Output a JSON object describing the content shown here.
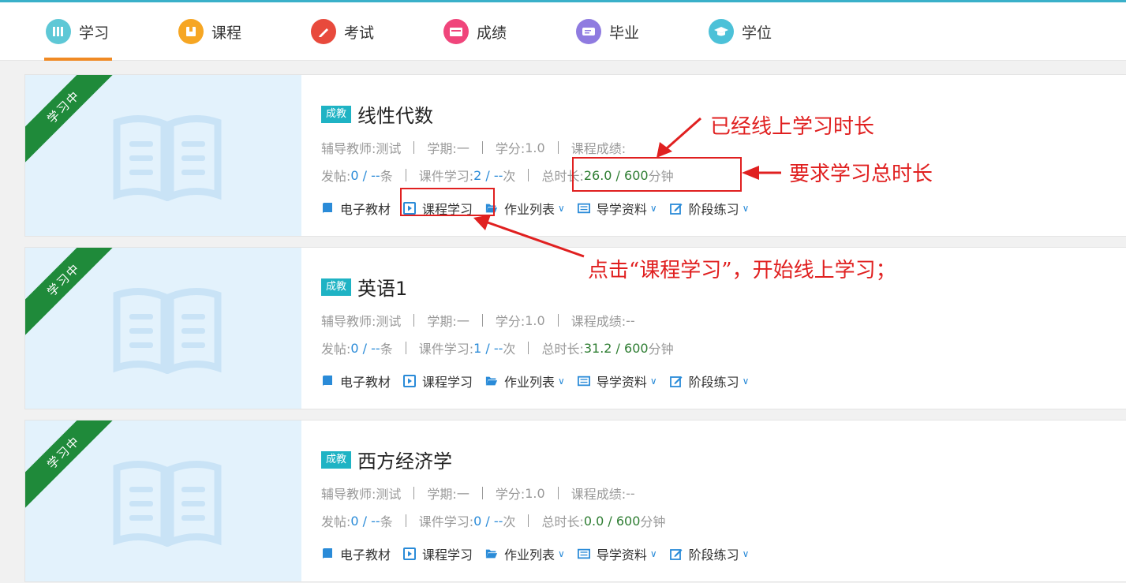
{
  "nav": {
    "items": [
      {
        "label": "学习",
        "icon": "study-icon",
        "color": "#5ec8d6",
        "active": true
      },
      {
        "label": "课程",
        "icon": "course-icon",
        "color": "#f6a623"
      },
      {
        "label": "考试",
        "icon": "exam-icon",
        "color": "#e84a3c"
      },
      {
        "label": "成绩",
        "icon": "score-icon",
        "color": "#f0457b"
      },
      {
        "label": "毕业",
        "icon": "graduation-cert-icon",
        "color": "#8f7be0"
      },
      {
        "label": "学位",
        "icon": "degree-cap-icon",
        "color": "#4cc1d8"
      }
    ],
    "accent": "#f08a24"
  },
  "ribbon_label": "学习中",
  "badge_label": "成教",
  "labels": {
    "teacher": "辅导教师: ",
    "term": "学期: ",
    "credit": "学分: ",
    "grade": "课程成绩: ",
    "posts": "发帖: ",
    "posts_unit": " 条",
    "courseware": "课件学习: ",
    "courseware_unit": " 次",
    "total_time": "总时长: ",
    "time_unit": " 分钟"
  },
  "actions": {
    "textbook": "电子教材",
    "course_study": "课程学习",
    "homework": "作业列表",
    "guide": "导学资料",
    "stage_practice": "阶段练习"
  },
  "courses": [
    {
      "title": "线性代数",
      "teacher": "测试",
      "term": "一",
      "credit": "1.0",
      "grade": "",
      "posts": "0 / --",
      "courseware": "2 / --",
      "time": "26.0 / 600"
    },
    {
      "title": "英语1",
      "teacher": "测试",
      "term": "一",
      "credit": "1.0",
      "grade": "--",
      "posts": "0 / --",
      "courseware": "1 / --",
      "time": "31.2 / 600"
    },
    {
      "title": "西方经济学",
      "teacher": "测试",
      "term": "一",
      "credit": "1.0",
      "grade": "--",
      "posts": "0 / --",
      "courseware": "0 / --",
      "time": "0.0 / 600"
    }
  ],
  "annotations": {
    "online_time": "已经线上学习时长",
    "required_time": "要求学习总时长",
    "click_hint": "点击“课程学习”，开始线上学习；"
  },
  "colors": {
    "annotation_red": "#e02020",
    "ribbon_green": "#1f8a3a",
    "badge_teal": "#1fb3c4",
    "link_blue": "#2a8bd8",
    "value_green": "#2e7d32"
  }
}
